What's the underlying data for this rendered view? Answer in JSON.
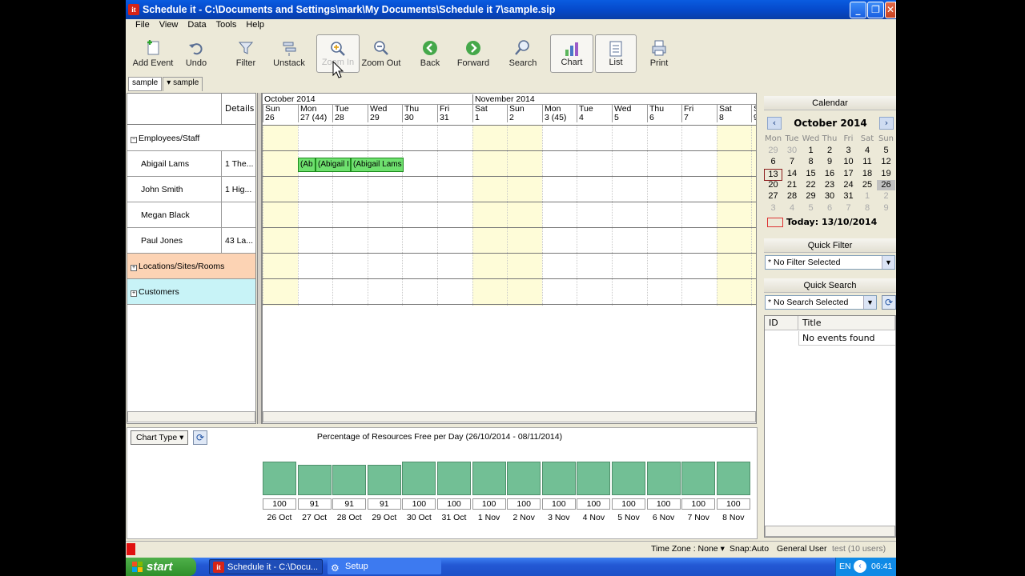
{
  "window": {
    "title": "Schedule it - C:\\Documents and Settings\\mark\\My Documents\\Schedule it 7\\sample.sip",
    "app_badge": "it"
  },
  "menu": [
    "File",
    "View",
    "Data",
    "Tools",
    "Help"
  ],
  "toolbar": [
    {
      "label": "Add Event",
      "icon": "add-event-icon"
    },
    {
      "label": "Undo",
      "icon": "undo-icon"
    },
    {
      "label": "Filter",
      "icon": "filter-icon"
    },
    {
      "label": "Unstack",
      "icon": "unstack-icon"
    },
    {
      "label": "Zoom In",
      "icon": "zoom-in-icon"
    },
    {
      "label": "Zoom Out",
      "icon": "zoom-out-icon"
    },
    {
      "label": "Back",
      "icon": "back-icon"
    },
    {
      "label": "Forward",
      "icon": "forward-icon"
    },
    {
      "label": "Search",
      "icon": "search-icon"
    },
    {
      "label": "Chart",
      "icon": "chart-icon"
    },
    {
      "label": "List",
      "icon": "list-icon"
    },
    {
      "label": "Print",
      "icon": "print-icon"
    }
  ],
  "tabs": [
    "sample",
    "sample"
  ],
  "resources": {
    "details_header": "Details",
    "groups": [
      {
        "label": "Employees/Staff",
        "color": "#ffffff"
      },
      {
        "label": "Locations/Sites/Rooms",
        "color": "#fcd3b4"
      },
      {
        "label": "Customers",
        "color": "#c8f3f7"
      }
    ],
    "rows": [
      {
        "name": "Abigail Lams",
        "details": "1 The..."
      },
      {
        "name": "John Smith",
        "details": "1 Hig..."
      },
      {
        "name": "Megan Black",
        "details": ""
      },
      {
        "name": "Paul Jones",
        "details": "43 La..."
      }
    ]
  },
  "timeline": {
    "months": [
      "October 2014",
      "November 2014"
    ],
    "days": [
      {
        "dow": "Sun",
        "date": "26",
        "weekend": true
      },
      {
        "dow": "Mon",
        "date": "27 (44)",
        "weekend": false
      },
      {
        "dow": "Tue",
        "date": "28",
        "weekend": false
      },
      {
        "dow": "Wed",
        "date": "29",
        "weekend": false
      },
      {
        "dow": "Thu",
        "date": "30",
        "weekend": false
      },
      {
        "dow": "Fri",
        "date": "31",
        "weekend": false
      },
      {
        "dow": "Sat",
        "date": "1",
        "weekend": true
      },
      {
        "dow": "Sun",
        "date": "2",
        "weekend": true
      },
      {
        "dow": "Mon",
        "date": "3 (45)",
        "weekend": false
      },
      {
        "dow": "Tue",
        "date": "4",
        "weekend": false
      },
      {
        "dow": "Wed",
        "date": "5",
        "weekend": false
      },
      {
        "dow": "Thu",
        "date": "6",
        "weekend": false
      },
      {
        "dow": "Fri",
        "date": "7",
        "weekend": false
      },
      {
        "dow": "Sat",
        "date": "8",
        "weekend": true
      },
      {
        "dow": "S",
        "date": "9",
        "weekend": true
      }
    ],
    "events": [
      "(Ab",
      "(Abigail I",
      "(Abigail Lams"
    ]
  },
  "chart": {
    "type_button": "Chart Type",
    "title": "Percentage of Resources Free per Day  (26/10/2014 - 08/11/2014)"
  },
  "chart_data": {
    "type": "bar",
    "title": "Percentage of Resources Free per Day  (26/10/2014 - 08/11/2014)",
    "categories": [
      "26 Oct",
      "27 Oct",
      "28 Oct",
      "29 Oct",
      "30 Oct",
      "31 Oct",
      "1 Nov",
      "2 Nov",
      "3 Nov",
      "4 Nov",
      "5 Nov",
      "6 Nov",
      "7 Nov",
      "8 Nov"
    ],
    "values": [
      100,
      91,
      91,
      91,
      100,
      100,
      100,
      100,
      100,
      100,
      100,
      100,
      100,
      100
    ],
    "ylim": [
      0,
      100
    ],
    "bar_color": "#72bf95"
  },
  "calendar": {
    "header": "Calendar",
    "month": "October 2014",
    "dow": [
      "Mon",
      "Tue",
      "Wed",
      "Thu",
      "Fri",
      "Sat",
      "Sun"
    ],
    "weeks": [
      [
        "29",
        "30",
        "1",
        "2",
        "3",
        "4",
        "5"
      ],
      [
        "6",
        "7",
        "8",
        "9",
        "10",
        "11",
        "12"
      ],
      [
        "13",
        "14",
        "15",
        "16",
        "17",
        "18",
        "19"
      ],
      [
        "20",
        "21",
        "22",
        "23",
        "24",
        "25",
        "26"
      ],
      [
        "27",
        "28",
        "29",
        "30",
        "31",
        "1",
        "2"
      ],
      [
        "3",
        "4",
        "5",
        "6",
        "7",
        "8",
        "9"
      ]
    ],
    "today_label": "Today: 13/10/2014"
  },
  "quick_filter": {
    "header": "Quick Filter",
    "value": "* No Filter Selected"
  },
  "quick_search": {
    "header": "Quick Search",
    "value": "* No Search Selected"
  },
  "search_results": {
    "col_id": "ID",
    "col_title": "Title",
    "empty": "No events found"
  },
  "status": {
    "timezone": "Time Zone : None",
    "snap": "Snap:Auto",
    "user": "General User",
    "db": "test (10 users)"
  },
  "taskbar": {
    "start": "start",
    "tasks": [
      "Schedule it - C:\\Docu...",
      "Setup"
    ],
    "lang": "EN",
    "time": "06:41"
  }
}
